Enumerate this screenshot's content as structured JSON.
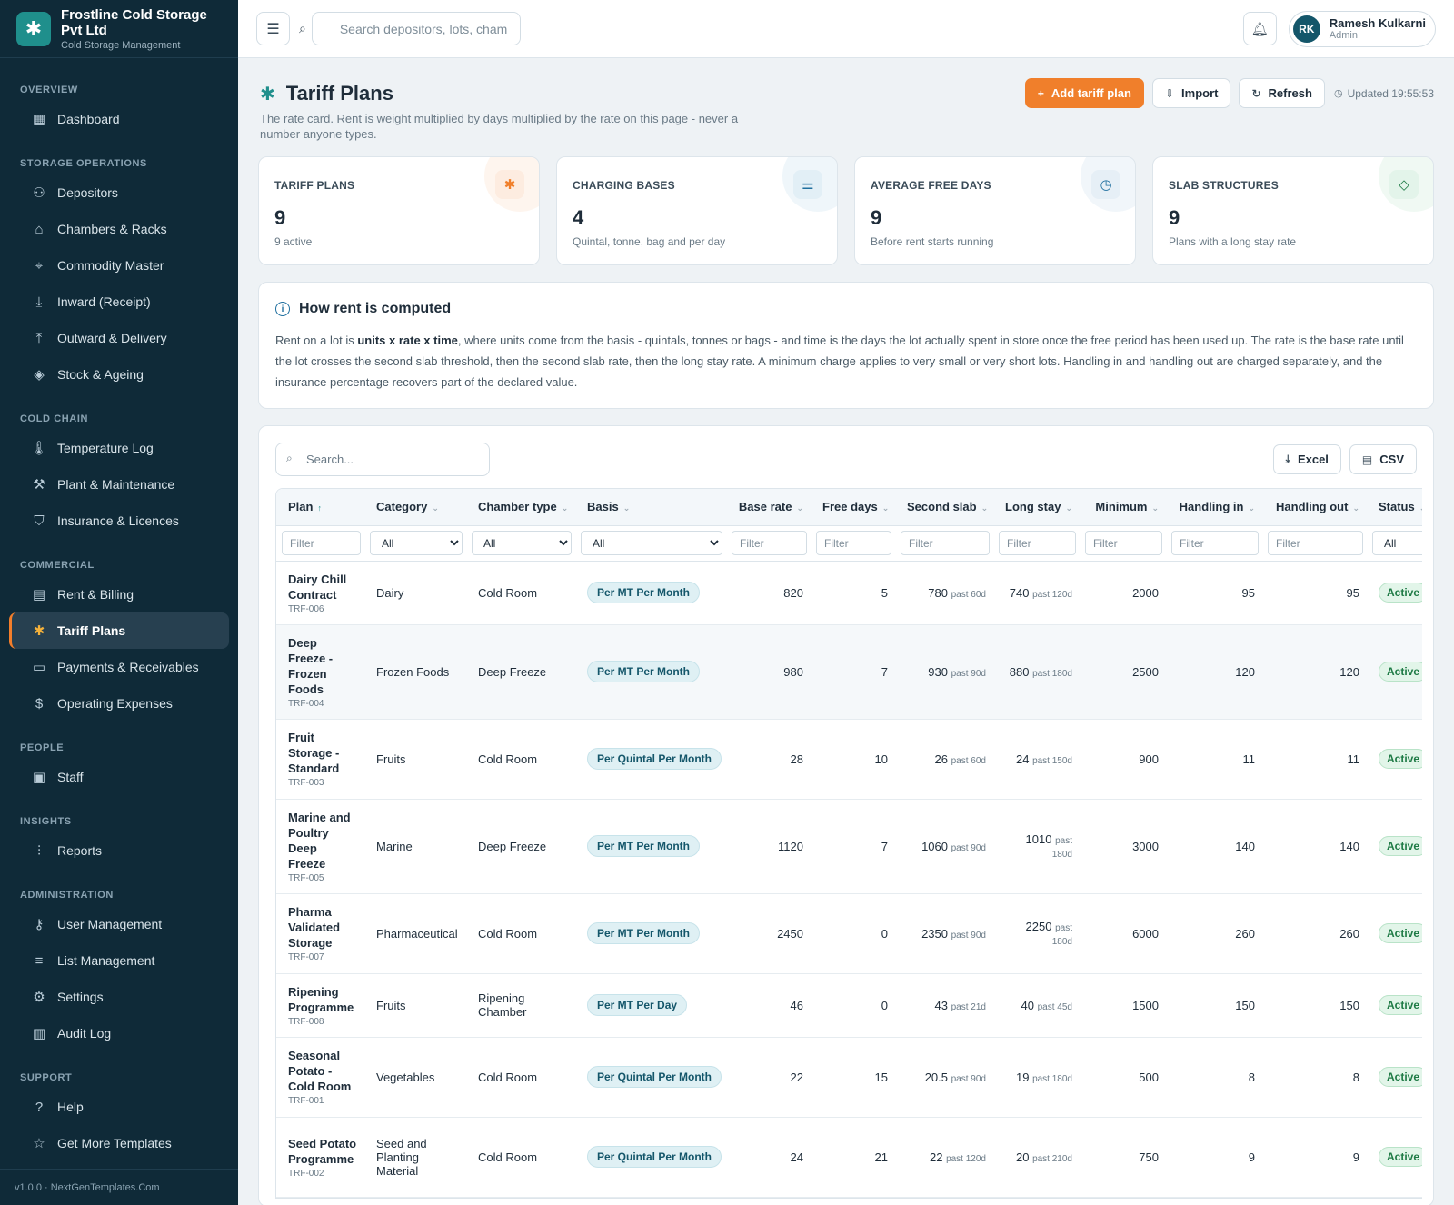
{
  "brand": {
    "name": "Frostline Cold Storage Pvt Ltd",
    "subtitle": "Cold Storage Management",
    "logo_icon": "snowflake-icon"
  },
  "sidebar": {
    "sections": [
      {
        "title": "OVERVIEW",
        "items": [
          {
            "label": "Dashboard",
            "icon": "grid-icon"
          }
        ]
      },
      {
        "title": "STORAGE OPERATIONS",
        "items": [
          {
            "label": "Depositors",
            "icon": "users-icon"
          },
          {
            "label": "Chambers & Racks",
            "icon": "warehouse-icon"
          },
          {
            "label": "Commodity Master",
            "icon": "tag-icon"
          },
          {
            "label": "Inward (Receipt)",
            "icon": "download-icon"
          },
          {
            "label": "Outward & Delivery",
            "icon": "upload-icon"
          },
          {
            "label": "Stock & Ageing",
            "icon": "box-icon"
          }
        ]
      },
      {
        "title": "COLD CHAIN",
        "items": [
          {
            "label": "Temperature Log",
            "icon": "thermometer-icon"
          },
          {
            "label": "Plant & Maintenance",
            "icon": "wrench-icon"
          },
          {
            "label": "Insurance & Licences",
            "icon": "shield-icon"
          }
        ]
      },
      {
        "title": "COMMERCIAL",
        "items": [
          {
            "label": "Rent & Billing",
            "icon": "receipt-icon"
          },
          {
            "label": "Tariff Plans",
            "icon": "snowflake-icon",
            "active": true
          },
          {
            "label": "Payments & Receivables",
            "icon": "wallet-icon"
          },
          {
            "label": "Operating Expenses",
            "icon": "dollar-icon"
          }
        ]
      },
      {
        "title": "PEOPLE",
        "items": [
          {
            "label": "Staff",
            "icon": "id-card-icon"
          }
        ]
      },
      {
        "title": "INSIGHTS",
        "items": [
          {
            "label": "Reports",
            "icon": "bar-chart-icon"
          }
        ]
      },
      {
        "title": "ADMINISTRATION",
        "items": [
          {
            "label": "User Management",
            "icon": "key-icon"
          },
          {
            "label": "List Management",
            "icon": "list-icon"
          },
          {
            "label": "Settings",
            "icon": "gear-icon"
          },
          {
            "label": "Audit Log",
            "icon": "clipboard-icon"
          }
        ]
      },
      {
        "title": "SUPPORT",
        "items": [
          {
            "label": "Help",
            "icon": "help-icon"
          },
          {
            "label": "Get More Templates",
            "icon": "star-icon"
          }
        ]
      }
    ],
    "footer": "v1.0.0 · NextGenTemplates.Com"
  },
  "topbar": {
    "search_placeholder": "Search depositors, lots, chambers...",
    "user": {
      "initials": "RK",
      "name": "Ramesh Kulkarni",
      "role": "Admin"
    }
  },
  "page": {
    "title": "Tariff Plans",
    "description": "The rate card. Rent is weight multiplied by days multiplied by the rate on this page - never a number anyone types.",
    "actions": {
      "add": "Add tariff plan",
      "import": "Import",
      "refresh": "Refresh"
    },
    "updated": "Updated 19:55:53"
  },
  "stats": [
    {
      "label": "TARIFF PLANS",
      "value": "9",
      "sub": "9 active",
      "icon": "snowflake-icon",
      "color": "#f07f2b",
      "bg": "#fdece0"
    },
    {
      "label": "CHARGING BASES",
      "value": "4",
      "sub": "Quintal, tonne, bag and per day",
      "icon": "sliders-icon",
      "color": "#1f6f9f",
      "bg": "#e2eff6"
    },
    {
      "label": "AVERAGE FREE DAYS",
      "value": "9",
      "sub": "Before rent starts running",
      "icon": "clock-icon",
      "color": "#1f6f9f",
      "bg": "#e6eff6"
    },
    {
      "label": "SLAB STRUCTURES",
      "value": "9",
      "sub": "Plans with a long stay rate",
      "icon": "layers-icon",
      "color": "#1e7a45",
      "bg": "#e3f4ea"
    }
  ],
  "info": {
    "title": "How rent is computed",
    "text_before": "Rent on a lot is ",
    "text_bold": "units x rate x time",
    "text_after": ", where units come from the basis - quintals, tonnes or bags - and time is the days the lot actually spent in store once the free period has been used up. The rate is the base rate until the lot crosses the second slab threshold, then the second slab rate, then the long stay rate. A minimum charge applies to very small or very short lots. Handling in and handling out are charged separately, and the insurance percentage recovers part of the declared value."
  },
  "table": {
    "search_placeholder": "Search...",
    "excel": "Excel",
    "csv": "CSV",
    "columns": [
      "Plan",
      "Category",
      "Chamber type",
      "Basis",
      "Base rate",
      "Free days",
      "Second slab",
      "Long stay",
      "Minimum",
      "Handling in",
      "Handling out",
      "Status"
    ],
    "filter_placeholder": "Filter",
    "select_all": "All",
    "rows": [
      {
        "name": "Dairy Chill Contract",
        "id": "TRF-006",
        "category": "Dairy",
        "chamber": "Cold Room",
        "basis": "Per MT Per Month",
        "base": "820",
        "free": "5",
        "slab": "780",
        "slab_past": "past 60d",
        "long": "740",
        "long_past": "past 120d",
        "min": "2000",
        "hin": "95",
        "hout": "95",
        "status": "Active"
      },
      {
        "name": "Deep Freeze - Frozen Foods",
        "id": "TRF-004",
        "category": "Frozen Foods",
        "chamber": "Deep Freeze",
        "basis": "Per MT Per Month",
        "base": "980",
        "free": "7",
        "slab": "930",
        "slab_past": "past 90d",
        "long": "880",
        "long_past": "past 180d",
        "min": "2500",
        "hin": "120",
        "hout": "120",
        "status": "Active"
      },
      {
        "name": "Fruit Storage - Standard",
        "id": "TRF-003",
        "category": "Fruits",
        "chamber": "Cold Room",
        "basis": "Per Quintal Per Month",
        "base": "28",
        "free": "10",
        "slab": "26",
        "slab_past": "past 60d",
        "long": "24",
        "long_past": "past 150d",
        "min": "900",
        "hin": "11",
        "hout": "11",
        "status": "Active"
      },
      {
        "name": "Marine and Poultry Deep Freeze",
        "id": "TRF-005",
        "category": "Marine",
        "chamber": "Deep Freeze",
        "basis": "Per MT Per Month",
        "base": "1120",
        "free": "7",
        "slab": "1060",
        "slab_past": "past 90d",
        "long": "1010",
        "long_past": "past 180d",
        "min": "3000",
        "hin": "140",
        "hout": "140",
        "status": "Active"
      },
      {
        "name": "Pharma Validated Storage",
        "id": "TRF-007",
        "category": "Pharmaceutical",
        "chamber": "Cold Room",
        "basis": "Per MT Per Month",
        "base": "2450",
        "free": "0",
        "slab": "2350",
        "slab_past": "past 90d",
        "long": "2250",
        "long_past": "past 180d",
        "min": "6000",
        "hin": "260",
        "hout": "260",
        "status": "Active"
      },
      {
        "name": "Ripening Programme",
        "id": "TRF-008",
        "category": "Fruits",
        "chamber": "Ripening Chamber",
        "basis": "Per MT Per Day",
        "base": "46",
        "free": "0",
        "slab": "43",
        "slab_past": "past 21d",
        "long": "40",
        "long_past": "past 45d",
        "min": "1500",
        "hin": "150",
        "hout": "150",
        "status": "Active"
      },
      {
        "name": "Seasonal Potato - Cold Room",
        "id": "TRF-001",
        "category": "Vegetables",
        "chamber": "Cold Room",
        "basis": "Per Quintal Per Month",
        "base": "22",
        "free": "15",
        "slab": "20.5",
        "slab_past": "past 90d",
        "long": "19",
        "long_past": "past 180d",
        "min": "500",
        "hin": "8",
        "hout": "8",
        "status": "Active"
      },
      {
        "name": "Seed Potato Programme",
        "id": "TRF-002",
        "category": "Seed and Planting Material",
        "chamber": "Cold Room",
        "basis": "Per Quintal Per Month",
        "base": "24",
        "free": "21",
        "slab": "22",
        "slab_past": "past 120d",
        "long": "20",
        "long_past": "past 210d",
        "min": "750",
        "hin": "9",
        "hout": "9",
        "status": "Active"
      }
    ]
  }
}
